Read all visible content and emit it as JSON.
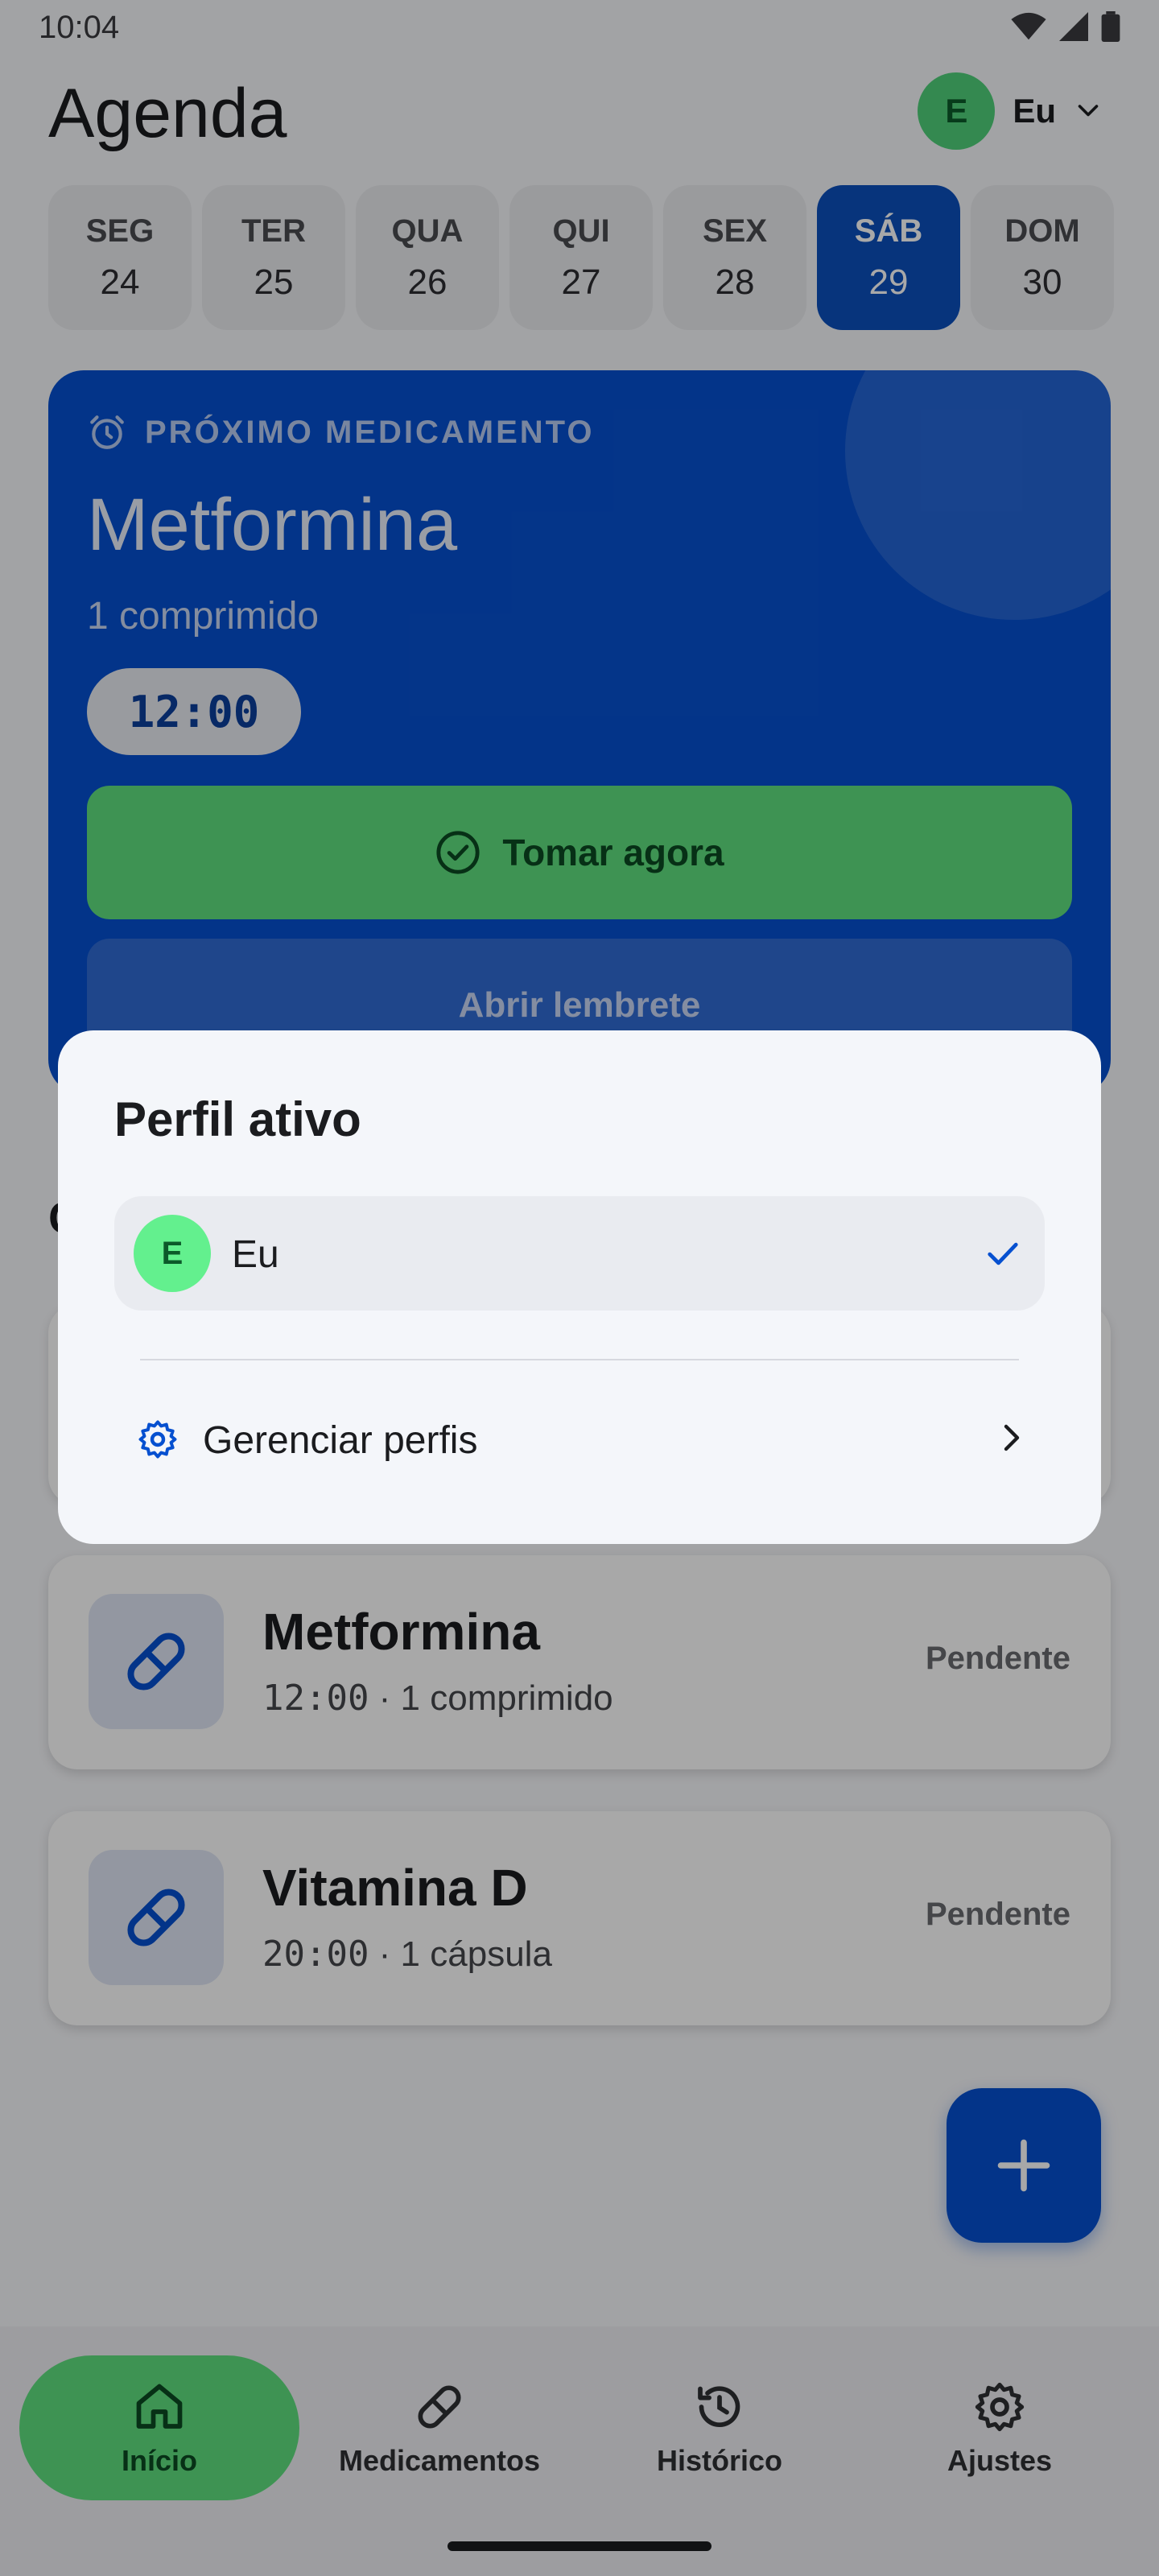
{
  "status_bar": {
    "time": "10:04"
  },
  "header": {
    "title": "Agenda",
    "profile": {
      "initial": "E",
      "name": "Eu"
    }
  },
  "days": [
    {
      "name": "SEG",
      "num": "24"
    },
    {
      "name": "TER",
      "num": "25"
    },
    {
      "name": "QUA",
      "num": "26"
    },
    {
      "name": "QUI",
      "num": "27"
    },
    {
      "name": "SEX",
      "num": "28"
    },
    {
      "name": "SÁB",
      "num": "29"
    },
    {
      "name": "DOM",
      "num": "30"
    }
  ],
  "selected_day": "SÁB",
  "next_medication": {
    "label": "PRÓXIMO MEDICAMENTO",
    "name": "Metformina",
    "dose": "1 comprimido",
    "time": "12:00",
    "take_button": "Tomar agora",
    "reminder_button": "Abrir lembrete"
  },
  "section_fragment": "C",
  "medications": [
    {
      "name": "Metformina",
      "time": "12:00",
      "detail": " · 1 comprimido",
      "status": "Pendente"
    },
    {
      "name": "Vitamina D",
      "time": "20:00",
      "detail": " · 1 cápsula",
      "status": "Pendente"
    }
  ],
  "nav": [
    {
      "label": "Início",
      "icon": "home-icon",
      "active": true
    },
    {
      "label": "Medicamentos",
      "icon": "pill-icon",
      "active": false
    },
    {
      "label": "Histórico",
      "icon": "history-icon",
      "active": false
    },
    {
      "label": "Ajustes",
      "icon": "gear-icon",
      "active": false
    }
  ],
  "dialog": {
    "title": "Perfil ativo",
    "profile": {
      "initial": "E",
      "name": "Eu"
    },
    "manage_label": "Gerenciar perfis"
  },
  "colors": {
    "primary": "#0650d0",
    "success": "#5fe07f",
    "avatar": "#4fd07a"
  }
}
